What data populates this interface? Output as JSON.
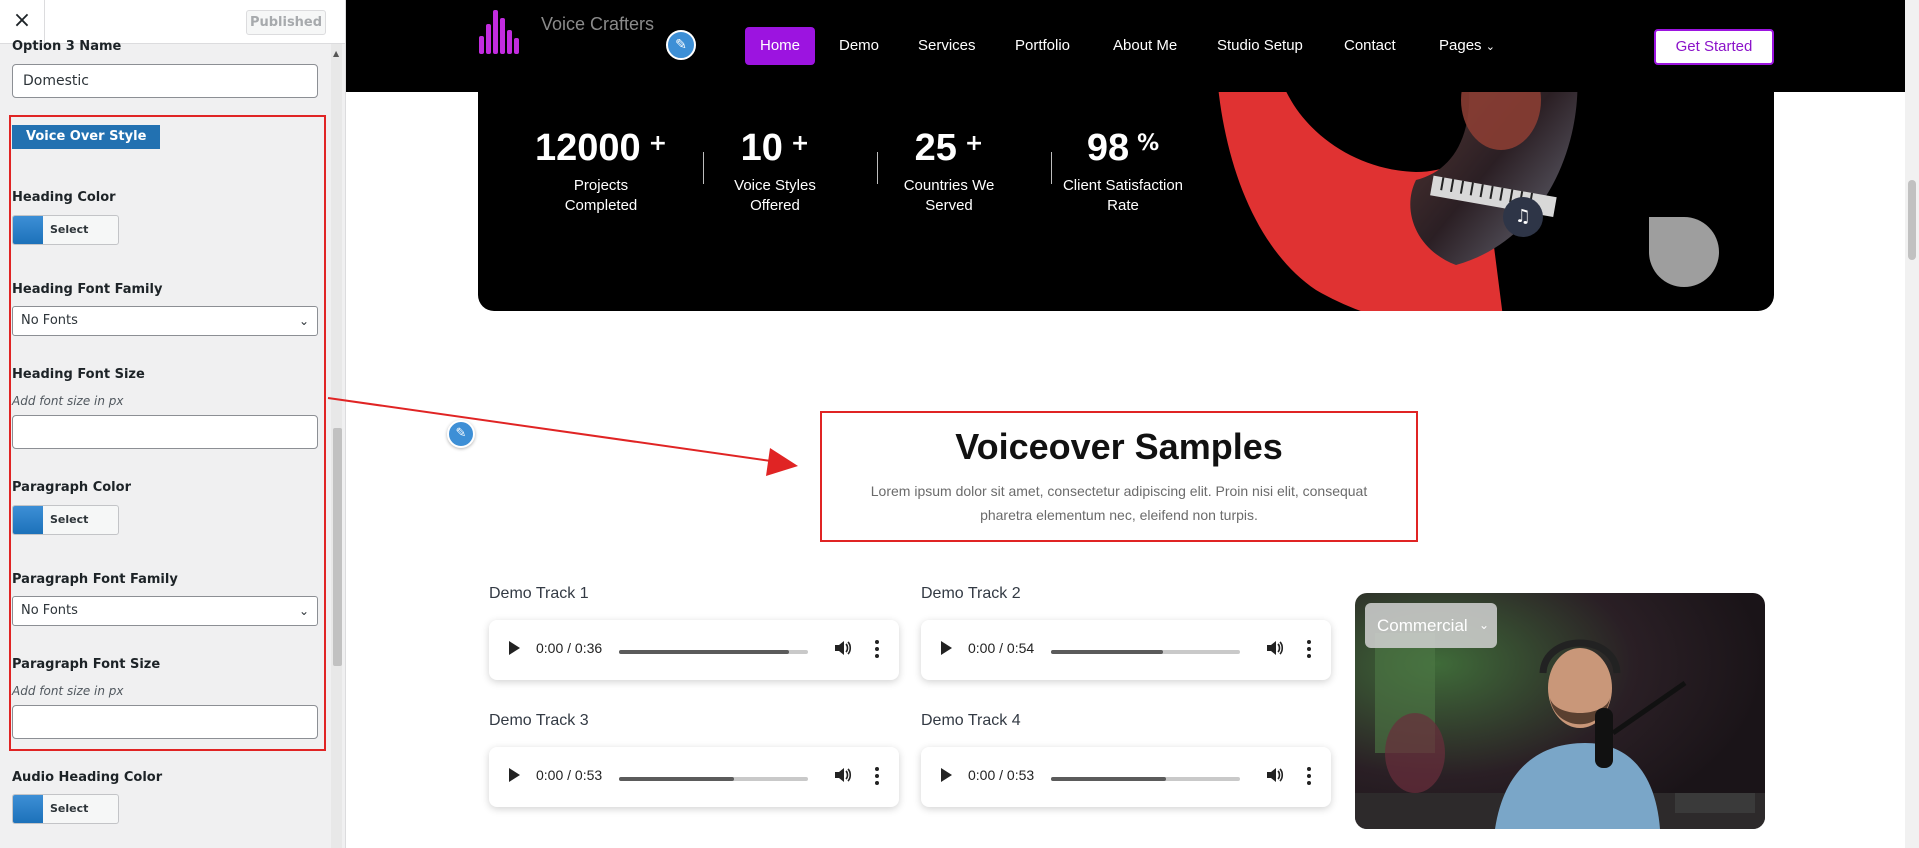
{
  "sidebar": {
    "close_label": "×",
    "publish_label": "Published",
    "option3_label": "Option 3 Name",
    "option3_value": "Domestic",
    "section_tag": "Voice Over Style",
    "heading_color_label": "Heading Color",
    "select_color_label": "Select Color",
    "heading_font_family_label": "Heading Font Family",
    "heading_font_family_value": "No Fonts",
    "heading_font_size_label": "Heading Font Size",
    "font_size_hint": "Add font size in px",
    "heading_font_size_value": "",
    "paragraph_color_label": "Paragraph Color",
    "paragraph_font_family_label": "Paragraph Font Family",
    "paragraph_font_family_value": "No Fonts",
    "paragraph_font_size_label": "Paragraph Font Size",
    "paragraph_font_size_value": "",
    "audio_heading_color_label": "Audio Heading Color"
  },
  "nav": {
    "logo_text": "Voice Crafters",
    "items": [
      "Home",
      "Demo",
      "Services",
      "Portfolio",
      "About Me",
      "Studio Setup",
      "Contact",
      "Pages"
    ],
    "cta": "Get Started",
    "accent": "#9c14e0"
  },
  "stats": [
    {
      "value": "12000",
      "suffix": "+",
      "label": "Projects Completed"
    },
    {
      "value": "10",
      "suffix": "+",
      "label": "Voice Styles Offered"
    },
    {
      "value": "25",
      "suffix": "+",
      "label": "Countries We Served"
    },
    {
      "value": "98",
      "suffix": "%",
      "label": "Client Satisfaction Rate"
    }
  ],
  "samples": {
    "title": "Voiceover Samples",
    "description": "Lorem ipsum dolor sit amet, consectetur adipiscing elit. Proin nisi elit, consequat pharetra elementum nec, eleifend non turpis."
  },
  "tracks": [
    {
      "title": "Demo Track 1",
      "time": "0:00 / 0:36",
      "progress": 0.9
    },
    {
      "title": "Demo Track 2",
      "time": "0:00 / 0:54",
      "progress": 0.59
    },
    {
      "title": "Demo Track 3",
      "time": "0:00 / 0:53",
      "progress": 0.61
    },
    {
      "title": "Demo Track 4",
      "time": "0:00 / 0:53",
      "progress": 0.61
    }
  ],
  "photo_select_value": "Commercial",
  "icons": {
    "close": "close-icon",
    "edit": "pencil-icon",
    "music": "music-note-icon",
    "volume": "volume-icon",
    "more": "more-vertical-icon",
    "chevron": "chevron-down-icon"
  },
  "colors": {
    "highlight": "#e02424",
    "customizer_blue": "#2271b1",
    "hero_bg": "#000000",
    "hero_red": "#e03232"
  }
}
